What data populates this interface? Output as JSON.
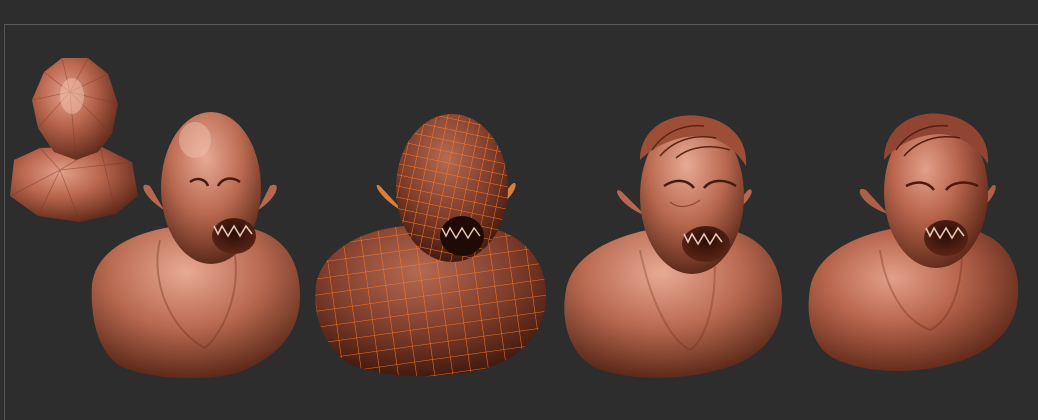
{
  "viewport": {
    "background": "#2d2d2d",
    "frame_color": "#5c5c5c"
  },
  "stages": [
    {
      "stage": "base-mesh",
      "style": "low-poly faceted",
      "color": "#b5644a"
    },
    {
      "stage": "first-sculpt",
      "style": "smooth bald head, pointed ears, open mouth",
      "color": "#b76a52"
    },
    {
      "stage": "topology-wireframe",
      "style": "orange polygroup grid overlay",
      "color": "#8f4a36",
      "wire_color": "#ff7a22"
    },
    {
      "stage": "detailed-sculpt-hair",
      "style": "wrinkles and swept hair",
      "color": "#b86b54"
    },
    {
      "stage": "final-sculpt",
      "style": "fine skin detail",
      "color": "#a95c46"
    }
  ]
}
